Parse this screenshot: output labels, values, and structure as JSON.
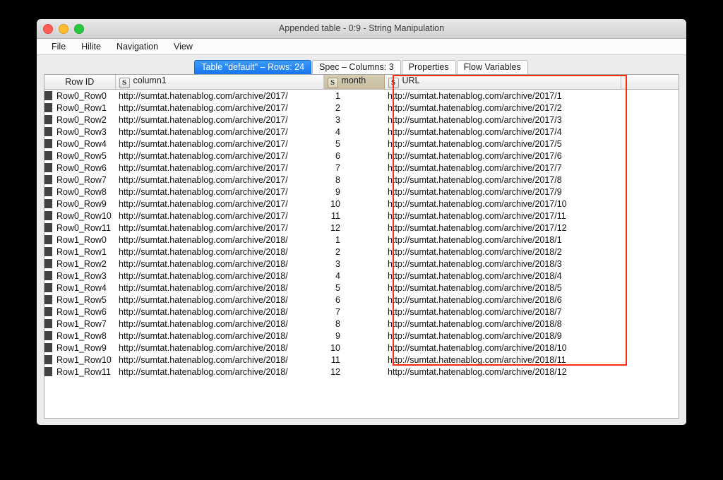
{
  "window": {
    "title": "Appended table - 0:9 - String Manipulation",
    "traffic_lights": [
      "close-button",
      "minimize-button",
      "zoom-button"
    ]
  },
  "menubar": {
    "items": [
      {
        "label": "File",
        "name": "menu-file"
      },
      {
        "label": "Hilite",
        "name": "menu-hilite"
      },
      {
        "label": "Navigation",
        "name": "menu-navigation"
      },
      {
        "label": "View",
        "name": "menu-view"
      }
    ]
  },
  "tabs": [
    {
      "label": "Table \"default\" – Rows: 24",
      "active": true
    },
    {
      "label": "Spec – Columns: 3",
      "active": false
    },
    {
      "label": "Properties",
      "active": false
    },
    {
      "label": "Flow Variables",
      "active": false
    }
  ],
  "table": {
    "columns": [
      {
        "header": "Row ID",
        "type_icon": "",
        "highlighted": false
      },
      {
        "header": "column1",
        "type_icon": "S",
        "highlighted": false
      },
      {
        "header": "month",
        "type_icon": "S",
        "highlighted": true
      },
      {
        "header": "URL",
        "type_icon": "S",
        "highlighted": false
      }
    ],
    "rows": [
      {
        "rowid": "Row0_Row0",
        "column1": "http://sumtat.hatenablog.com/archive/2017/",
        "month": "1",
        "url": "http://sumtat.hatenablog.com/archive/2017/1"
      },
      {
        "rowid": "Row0_Row1",
        "column1": "http://sumtat.hatenablog.com/archive/2017/",
        "month": "2",
        "url": "http://sumtat.hatenablog.com/archive/2017/2"
      },
      {
        "rowid": "Row0_Row2",
        "column1": "http://sumtat.hatenablog.com/archive/2017/",
        "month": "3",
        "url": "http://sumtat.hatenablog.com/archive/2017/3"
      },
      {
        "rowid": "Row0_Row3",
        "column1": "http://sumtat.hatenablog.com/archive/2017/",
        "month": "4",
        "url": "http://sumtat.hatenablog.com/archive/2017/4"
      },
      {
        "rowid": "Row0_Row4",
        "column1": "http://sumtat.hatenablog.com/archive/2017/",
        "month": "5",
        "url": "http://sumtat.hatenablog.com/archive/2017/5"
      },
      {
        "rowid": "Row0_Row5",
        "column1": "http://sumtat.hatenablog.com/archive/2017/",
        "month": "6",
        "url": "http://sumtat.hatenablog.com/archive/2017/6"
      },
      {
        "rowid": "Row0_Row6",
        "column1": "http://sumtat.hatenablog.com/archive/2017/",
        "month": "7",
        "url": "http://sumtat.hatenablog.com/archive/2017/7"
      },
      {
        "rowid": "Row0_Row7",
        "column1": "http://sumtat.hatenablog.com/archive/2017/",
        "month": "8",
        "url": "http://sumtat.hatenablog.com/archive/2017/8"
      },
      {
        "rowid": "Row0_Row8",
        "column1": "http://sumtat.hatenablog.com/archive/2017/",
        "month": "9",
        "url": "http://sumtat.hatenablog.com/archive/2017/9"
      },
      {
        "rowid": "Row0_Row9",
        "column1": "http://sumtat.hatenablog.com/archive/2017/",
        "month": "10",
        "url": "http://sumtat.hatenablog.com/archive/2017/10"
      },
      {
        "rowid": "Row0_Row10",
        "column1": "http://sumtat.hatenablog.com/archive/2017/",
        "month": "11",
        "url": "http://sumtat.hatenablog.com/archive/2017/11"
      },
      {
        "rowid": "Row0_Row11",
        "column1": "http://sumtat.hatenablog.com/archive/2017/",
        "month": "12",
        "url": "http://sumtat.hatenablog.com/archive/2017/12"
      },
      {
        "rowid": "Row1_Row0",
        "column1": "http://sumtat.hatenablog.com/archive/2018/",
        "month": "1",
        "url": "http://sumtat.hatenablog.com/archive/2018/1"
      },
      {
        "rowid": "Row1_Row1",
        "column1": "http://sumtat.hatenablog.com/archive/2018/",
        "month": "2",
        "url": "http://sumtat.hatenablog.com/archive/2018/2"
      },
      {
        "rowid": "Row1_Row2",
        "column1": "http://sumtat.hatenablog.com/archive/2018/",
        "month": "3",
        "url": "http://sumtat.hatenablog.com/archive/2018/3"
      },
      {
        "rowid": "Row1_Row3",
        "column1": "http://sumtat.hatenablog.com/archive/2018/",
        "month": "4",
        "url": "http://sumtat.hatenablog.com/archive/2018/4"
      },
      {
        "rowid": "Row1_Row4",
        "column1": "http://sumtat.hatenablog.com/archive/2018/",
        "month": "5",
        "url": "http://sumtat.hatenablog.com/archive/2018/5"
      },
      {
        "rowid": "Row1_Row5",
        "column1": "http://sumtat.hatenablog.com/archive/2018/",
        "month": "6",
        "url": "http://sumtat.hatenablog.com/archive/2018/6"
      },
      {
        "rowid": "Row1_Row6",
        "column1": "http://sumtat.hatenablog.com/archive/2018/",
        "month": "7",
        "url": "http://sumtat.hatenablog.com/archive/2018/7"
      },
      {
        "rowid": "Row1_Row7",
        "column1": "http://sumtat.hatenablog.com/archive/2018/",
        "month": "8",
        "url": "http://sumtat.hatenablog.com/archive/2018/8"
      },
      {
        "rowid": "Row1_Row8",
        "column1": "http://sumtat.hatenablog.com/archive/2018/",
        "month": "9",
        "url": "http://sumtat.hatenablog.com/archive/2018/9"
      },
      {
        "rowid": "Row1_Row9",
        "column1": "http://sumtat.hatenablog.com/archive/2018/",
        "month": "10",
        "url": "http://sumtat.hatenablog.com/archive/2018/10"
      },
      {
        "rowid": "Row1_Row10",
        "column1": "http://sumtat.hatenablog.com/archive/2018/",
        "month": "11",
        "url": "http://sumtat.hatenablog.com/archive/2018/11"
      },
      {
        "rowid": "Row1_Row11",
        "column1": "http://sumtat.hatenablog.com/archive/2018/",
        "month": "12",
        "url": "http://sumtat.hatenablog.com/archive/2018/12"
      }
    ]
  },
  "annotation": {
    "name": "url-column-highlight",
    "color": "#ff2b11"
  }
}
